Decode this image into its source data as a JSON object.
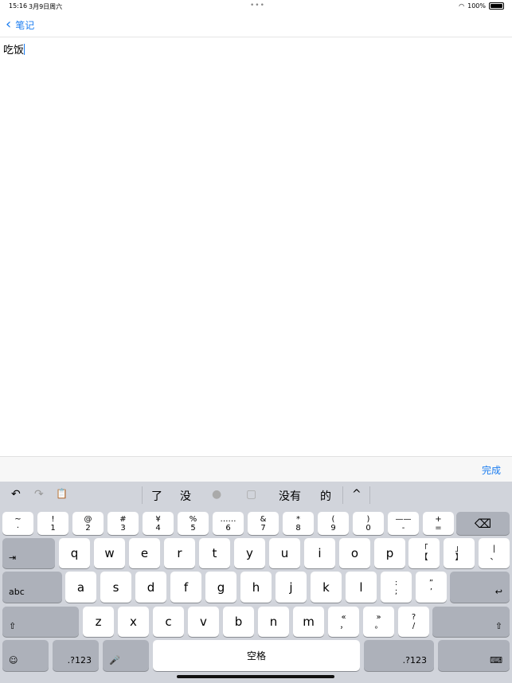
{
  "status": {
    "time": "15:16",
    "date": "3月9日周六",
    "battery": "100%"
  },
  "nav": {
    "back_label": "笔记"
  },
  "note": {
    "text": "吃饭"
  },
  "accessory": {
    "done_label": "完成"
  },
  "keyboard": {
    "toolbar": {
      "undo": "↶",
      "redo": "↷",
      "paste": "📋",
      "candidates": [
        "了",
        "没",
        "没有",
        "的"
      ],
      "expand": "^"
    },
    "row0": [
      [
        "~",
        "·"
      ],
      [
        "!",
        "1"
      ],
      [
        "@",
        "2"
      ],
      [
        "#",
        "3"
      ],
      [
        "¥",
        "4"
      ],
      [
        "%",
        "5"
      ],
      [
        "……",
        "6"
      ],
      [
        "&",
        "7"
      ],
      [
        "*",
        "8"
      ],
      [
        "(",
        "9"
      ],
      [
        ")",
        "0"
      ],
      [
        "——",
        "-"
      ],
      [
        "+",
        "="
      ]
    ],
    "row1": [
      "q",
      "w",
      "e",
      "r",
      "t",
      "y",
      "u",
      "i",
      "o",
      "p"
    ],
    "row1_extra": [
      [
        "「",
        "【"
      ],
      [
        "」",
        "】"
      ],
      [
        "|",
        "、"
      ]
    ],
    "row2": [
      "a",
      "s",
      "d",
      "f",
      "g",
      "h",
      "j",
      "k",
      "l"
    ],
    "row2_extra": [
      [
        ":",
        ";"
      ],
      [
        "”",
        "’"
      ]
    ],
    "row3": [
      "z",
      "x",
      "c",
      "v",
      "b",
      "n",
      "m"
    ],
    "row3_extra": [
      [
        "«",
        "，"
      ],
      [
        "»",
        "。"
      ],
      [
        "?",
        "/"
      ]
    ],
    "labels": {
      "tab": "⇥",
      "delete": "⌫",
      "abc": "abc",
      "return": "↩",
      "shift": "⇧",
      "emoji": "☺",
      "num_left": ".?123",
      "mic": "🎤",
      "space": "空格",
      "num_right": ".?123",
      "hide": "⌨"
    }
  }
}
